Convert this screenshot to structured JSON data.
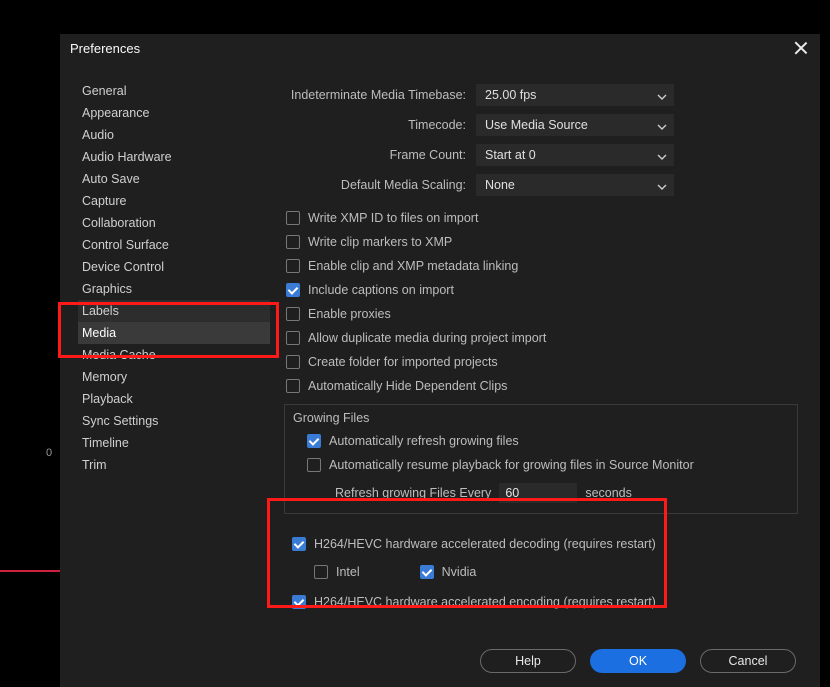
{
  "dialog": {
    "title": "Preferences"
  },
  "sidebar": {
    "items": [
      "General",
      "Appearance",
      "Audio",
      "Audio Hardware",
      "Auto Save",
      "Capture",
      "Collaboration",
      "Control Surface",
      "Device Control",
      "Graphics",
      "Labels",
      "Media",
      "Media Cache",
      "Memory",
      "Playback",
      "Sync Settings",
      "Timeline",
      "Trim"
    ],
    "selected": "Media",
    "hover": "Labels"
  },
  "form": {
    "timebase": {
      "label": "Indeterminate Media Timebase:",
      "value": "25.00 fps"
    },
    "timecode": {
      "label": "Timecode:",
      "value": "Use Media Source"
    },
    "framecount": {
      "label": "Frame Count:",
      "value": "Start at 0"
    },
    "scaling": {
      "label": "Default Media Scaling:",
      "value": "None"
    }
  },
  "checks": {
    "xmp_id": {
      "label": "Write XMP ID to files on import",
      "checked": false
    },
    "clip_markers": {
      "label": "Write clip markers to XMP",
      "checked": false
    },
    "xmp_linking": {
      "label": "Enable clip and XMP metadata linking",
      "checked": false
    },
    "captions": {
      "label": "Include captions on import",
      "checked": true
    },
    "proxies": {
      "label": "Enable proxies",
      "checked": false
    },
    "dup_media": {
      "label": "Allow duplicate media during project import",
      "checked": false
    },
    "create_folder": {
      "label": "Create folder for imported projects",
      "checked": false
    },
    "hide_deps": {
      "label": "Automatically Hide Dependent Clips",
      "checked": false
    }
  },
  "growing": {
    "title": "Growing Files",
    "auto_refresh": {
      "label": "Automatically refresh growing files",
      "checked": true
    },
    "auto_resume": {
      "label": "Automatically resume playback for growing files in Source Monitor",
      "checked": false
    },
    "refresh_label_pre": "Refresh growing Files Every",
    "refresh_value": "60",
    "refresh_label_post": "seconds"
  },
  "hw": {
    "decode": {
      "label": "H264/HEVC hardware accelerated decoding (requires restart)",
      "checked": true
    },
    "intel": {
      "label": "Intel",
      "checked": false
    },
    "nvidia": {
      "label": "Nvidia",
      "checked": true
    },
    "encode": {
      "label": "H264/HEVC hardware accelerated encoding (requires restart)",
      "checked": true
    }
  },
  "buttons": {
    "help": "Help",
    "ok": "OK",
    "cancel": "Cancel"
  },
  "timeline_tick": "0"
}
